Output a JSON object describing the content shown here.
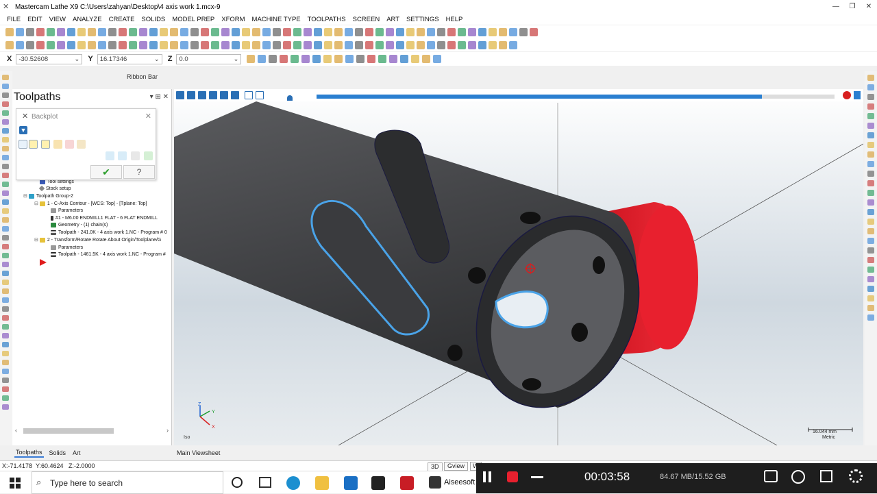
{
  "window": {
    "title": "Mastercam Lathe X9  C:\\Users\\zahyan\\Desktop\\4 axis work 1.mcx-9",
    "minimize": "—",
    "maximize": "❐",
    "close": "✕"
  },
  "menu": [
    "FILE",
    "EDIT",
    "VIEW",
    "ANALYZE",
    "CREATE",
    "SOLIDS",
    "MODEL PREP",
    "XFORM",
    "MACHINE TYPE",
    "TOOLPATHS",
    "SCREEN",
    "ART",
    "SETTINGS",
    "HELP"
  ],
  "coords": {
    "x_label": "X",
    "x_value": "-30.52608",
    "y_label": "Y",
    "y_value": "16.17346",
    "z_label": "Z",
    "z_value": "0.0"
  },
  "ribbon_bar_label": "Ribbon Bar",
  "toolpaths_panel": {
    "title": "Toolpaths",
    "controls": "▾ ⊞ ✕",
    "tree": [
      "Tool settings",
      "Stock setup",
      "Toolpath Group-2",
      "1 - C-Axis Contour - [WCS: Top] - [Tplane: Top]",
      "Parameters",
      "#1 - M6.00 ENDMILL1 FLAT - 6 FLAT ENDMILL",
      "Geometry - (1) chain(s)",
      "Toolpath - 241.0K - 4 axis work 1.NC - Program # 0",
      "2 - Transform/Rotate Rotate About Origin/Toolplane/G",
      "Parameters",
      "Toolpath - 1461.5K - 4 axis work 1.NC - Program #"
    ]
  },
  "backplot": {
    "title": "Backplot",
    "close": "✕",
    "ok_glyph": "✔",
    "help_glyph": "?"
  },
  "scroll": {
    "left": "‹",
    "right": "›"
  },
  "bottom_tabs": [
    "Toolpaths",
    "Solids",
    "Art"
  ],
  "viewport": {
    "view_label": "Iso",
    "scale_value": "16.044 mm",
    "scale_unit": "Metric",
    "axis_z": "Z",
    "axis_y": "Y",
    "axis_x": "X",
    "playback_progress": 0.86
  },
  "viewsheet_tab": "Main Viewsheet",
  "status": {
    "x": "X:-71.4178",
    "y": "Y:60.4624",
    "z": "Z:-2.0000",
    "mode": "3D",
    "gview": "Gview",
    "wcs": "W"
  },
  "recorder": {
    "time": "00:03:58",
    "size": "84.67 MB/15.52 GB"
  },
  "taskbar": {
    "search_placeholder": "Type here to search",
    "aiseesoft_label": "Aiseesoft S"
  },
  "colors": {
    "accent_blue": "#2a6fb5",
    "stock_red": "#e8202e",
    "part_dark": "#4a4b4d",
    "toolpath_blue": "#4aa3e8"
  }
}
